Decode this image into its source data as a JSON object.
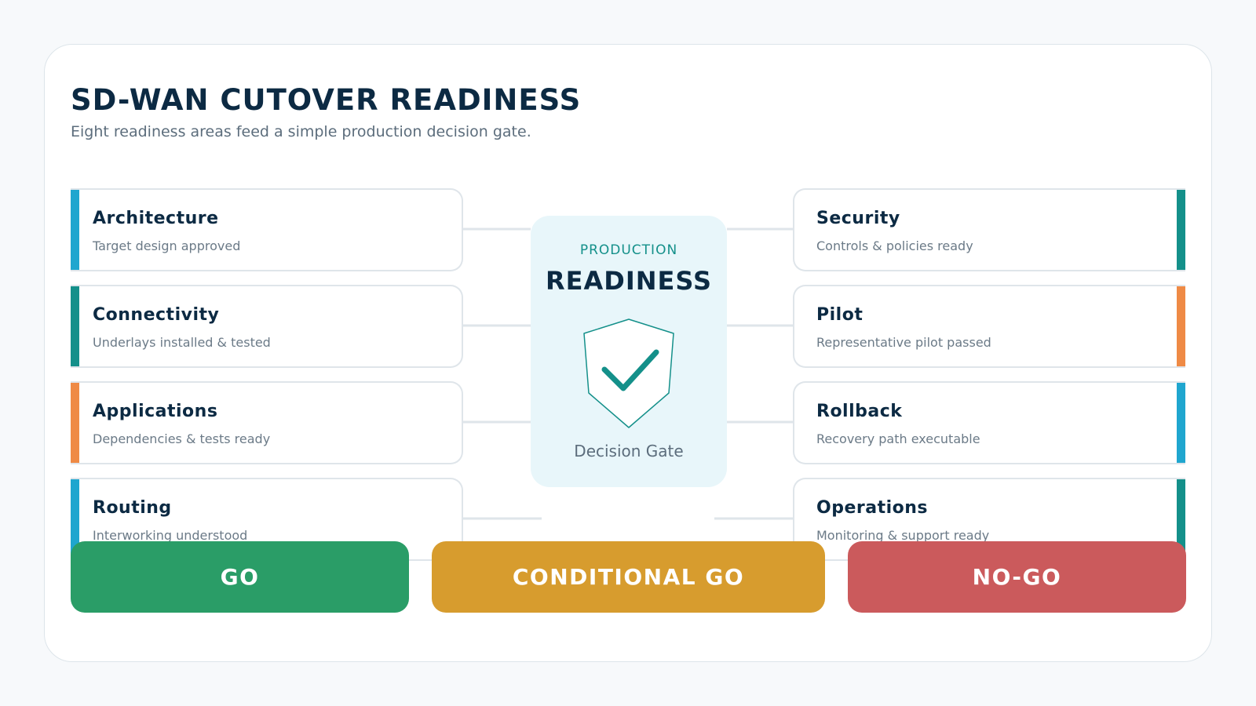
{
  "header": {
    "title": "SD-WAN CUTOVER READINESS",
    "subtitle": "Eight readiness areas feed a simple production decision gate."
  },
  "areas_left": [
    {
      "title": "Architecture",
      "subtitle": "Target design approved",
      "accent": "#1fa6cf"
    },
    {
      "title": "Connectivity",
      "subtitle": "Underlays installed & tested",
      "accent": "#14908a"
    },
    {
      "title": "Applications",
      "subtitle": "Dependencies & tests ready",
      "accent": "#ef8a45"
    },
    {
      "title": "Routing",
      "subtitle": "Interworking understood",
      "accent": "#1fa6cf"
    }
  ],
  "areas_right": [
    {
      "title": "Security",
      "subtitle": "Controls & policies ready",
      "accent": "#14908a"
    },
    {
      "title": "Pilot",
      "subtitle": "Representative pilot passed",
      "accent": "#ef8a45"
    },
    {
      "title": "Rollback",
      "subtitle": "Recovery path executable",
      "accent": "#1fa6cf"
    },
    {
      "title": "Operations",
      "subtitle": "Monitoring & support ready",
      "accent": "#14908a"
    }
  ],
  "gate": {
    "kicker": "PRODUCTION",
    "title": "READINESS",
    "label": "Decision Gate",
    "icon": "shield-check-icon",
    "color": "#14908a"
  },
  "decisions": [
    {
      "label": "GO",
      "color": "#2a9d67"
    },
    {
      "label": "CONDITIONAL GO",
      "color": "#d79c2e"
    },
    {
      "label": "NO-GO",
      "color": "#cb5a5c"
    }
  ]
}
